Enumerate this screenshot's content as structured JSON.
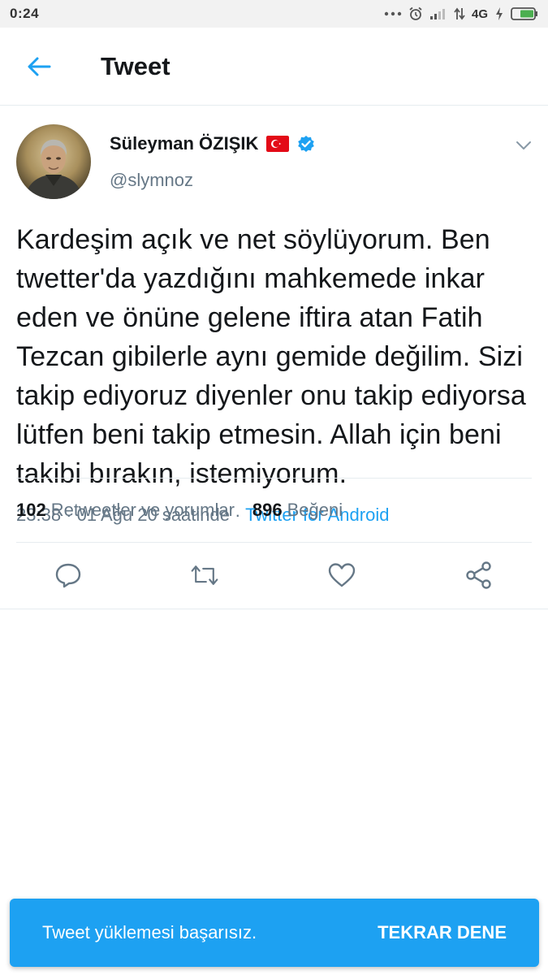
{
  "status_bar": {
    "time": "0:24",
    "network": "4G",
    "icons": [
      "dots-icon",
      "alarm-icon",
      "signal-icon",
      "data-arrows-icon",
      "charging-icon",
      "battery-icon"
    ]
  },
  "header": {
    "title": "Tweet",
    "back_icon": "arrow-left-icon"
  },
  "tweet": {
    "author_name": "Süleyman ÖZIŞIK",
    "handle": "@slymnoz",
    "text": "Kardeşim açık ve net söylüyorum. Ben twetter'da yazdığını mahkemede inkar eden ve önüne gelene iftira atan Fatih Tezcan gibilerle aynı gemide değilim. Sizi takip ediyoruz diyenler onu takip ediyorsa lütfen beni takip etmesin. Allah için beni takibi bırakın, istemiyorum.",
    "timestamp": "23:38 · 01 Ağu 20 saatinde · ",
    "source": "Twitter for Android"
  },
  "stats": {
    "retweets_count": "102",
    "retweets_label": "Retweetler ve yorumlar",
    "likes_count": "896",
    "likes_label": "Beğeni"
  },
  "toast": {
    "message": "Tweet yüklemesi başarısız.",
    "action": "TEKRAR DENE"
  },
  "colors": {
    "accent": "#1da1f2",
    "text_primary": "#14171a",
    "text_secondary": "#657786",
    "divider": "#e6ecf0"
  }
}
